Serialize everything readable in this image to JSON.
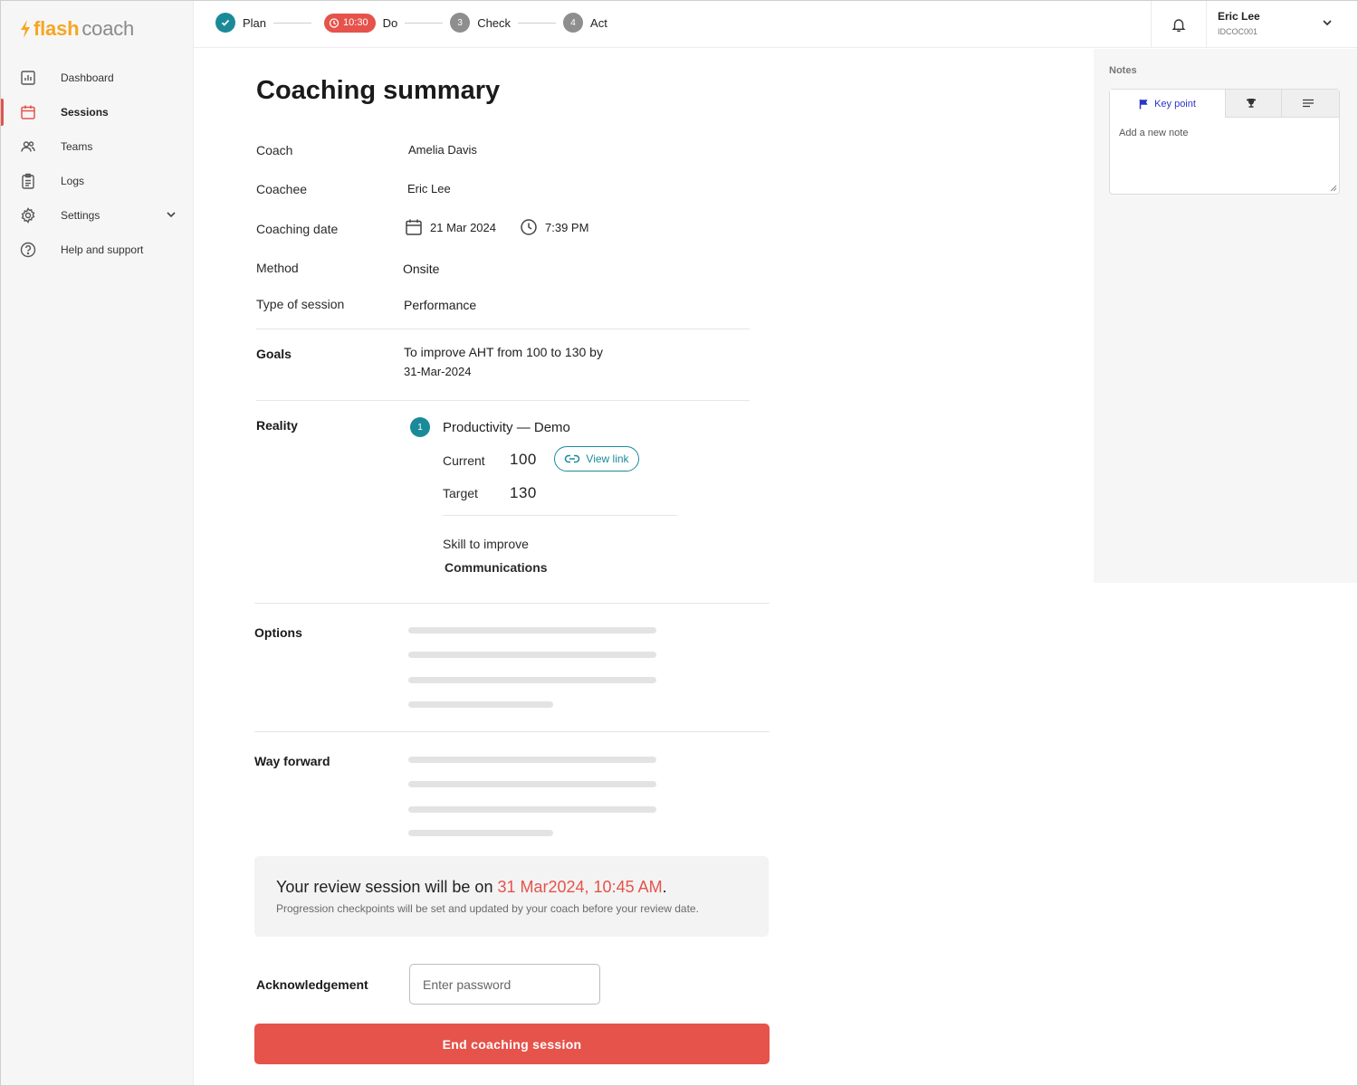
{
  "brand": {
    "flash": "flash",
    "coach": "coach"
  },
  "sidebar": {
    "items": [
      {
        "label": "Dashboard"
      },
      {
        "label": "Sessions"
      },
      {
        "label": "Teams"
      },
      {
        "label": "Logs"
      },
      {
        "label": "Settings"
      },
      {
        "label": "Help and support"
      }
    ]
  },
  "steps": {
    "plan": "Plan",
    "timer": "10:30",
    "do": "Do",
    "check_num": "3",
    "check": "Check",
    "act_num": "4",
    "act": "Act"
  },
  "user": {
    "name": "Eric Lee",
    "id": "IDCOC001"
  },
  "notes": {
    "title": "Notes",
    "tab_key_point": "Key point",
    "placeholder": "Add a new note"
  },
  "summary": {
    "title": "Coaching summary",
    "coach_label": "Coach",
    "coach": "Amelia Davis",
    "coachee_label": "Coachee",
    "coachee": "Eric Lee",
    "date_label": "Coaching date",
    "date": "21 Mar 2024",
    "time": "7:39 PM",
    "method_label": "Method",
    "method": "Onsite",
    "type_label": "Type of session",
    "type": "Performance",
    "goals_label": "Goals",
    "goals_line1": "To improve AHT from 100 to 130  by",
    "goals_line2": "31-Mar-2024",
    "reality_label": "Reality",
    "reality_num": "1",
    "reality_title": "Productivity — Demo",
    "current_label": "Current",
    "current": "100",
    "view_link": "View link",
    "target_label": "Target",
    "target": "130",
    "skill_label": "Skill to improve",
    "skill": "Communications",
    "options_label": "Options",
    "way_forward_label": "Way forward"
  },
  "review": {
    "prefix": "Your review session will be on",
    "date": "31 Mar2024, 10:45 AM",
    "suffix": ".",
    "sub": "Progression checkpoints will be set and updated by your coach before your review date."
  },
  "ack": {
    "label": "Acknowledgement",
    "placeholder": "Enter password",
    "button": "End coaching session"
  },
  "colors": {
    "accent": "#e5534b",
    "teal": "#1a8a99",
    "brand": "#f5a623",
    "link_blue": "#2b35c8"
  }
}
